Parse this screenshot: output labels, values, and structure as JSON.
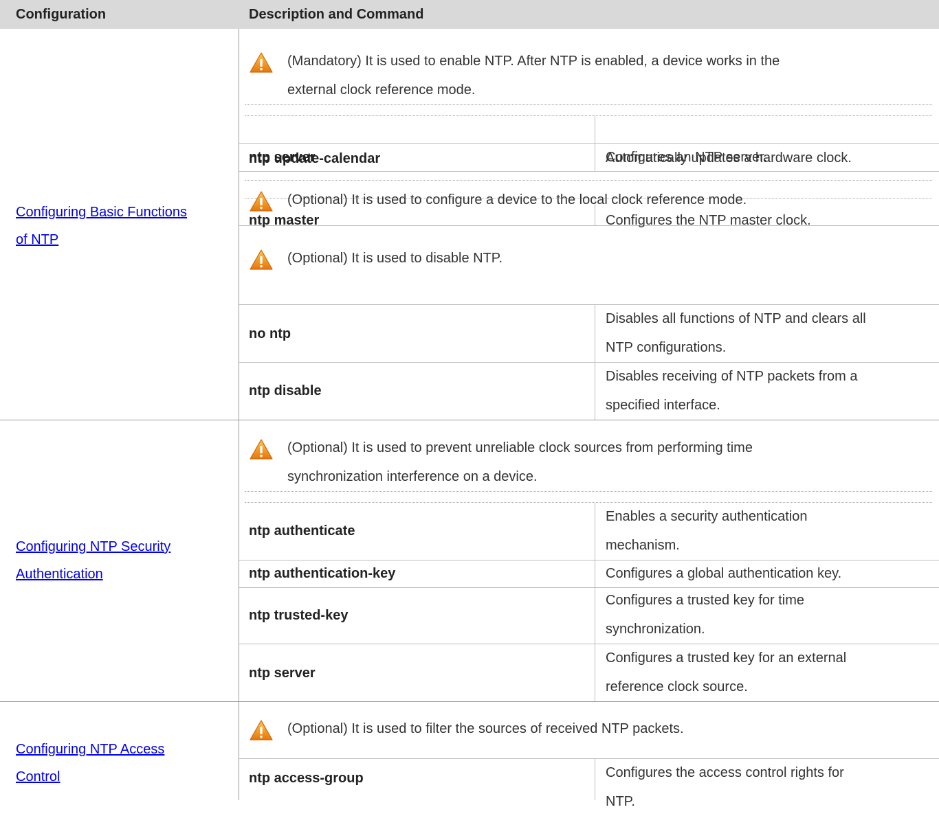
{
  "header": {
    "configuration": "Configuration",
    "description_and_command": "Description and Command"
  },
  "groups": [
    {
      "link": [
        "Configuring Basic Functions ",
        "of NTP"
      ],
      "notes": [
        [
          "(Mandatory) It is used to enable NTP. After NTP is enabled, a device works in the",
          "external clock reference mode."
        ],
        [
          "(Optional) It is used to configure a device to the local clock reference mode."
        ],
        [
          "(Optional) It is used to disable NTP."
        ]
      ],
      "commands": [
        {
          "command": "ntp server",
          "description": [
            "Configures an NTP server."
          ]
        },
        {
          "command": "ntp update-calendar",
          "description": [
            "Automatically updates a hardware clock."
          ]
        },
        {
          "command": "ntp master",
          "description": [
            "Configures the NTP master clock."
          ]
        },
        {
          "command": "no ntp",
          "description": [
            "Disables all functions of NTP and clears all",
            "NTP configurations."
          ]
        },
        {
          "command": "ntp disable",
          "description": [
            "Disables receiving of NTP packets from a",
            "specified interface."
          ]
        }
      ]
    },
    {
      "link": [
        "Configuring NTP Security ",
        "Authentication"
      ],
      "notes": [
        [
          "(Optional) It is used to prevent unreliable clock sources from performing time",
          "synchronization interference on a device."
        ]
      ],
      "commands": [
        {
          "command": "ntp authenticate",
          "description": [
            "Enables a security authentication",
            "mechanism."
          ]
        },
        {
          "command": "ntp authentication-key",
          "description": [
            "Configures a global authentication key."
          ]
        },
        {
          "command": "ntp trusted-key",
          "description": [
            "Configures a trusted key for time",
            "synchronization."
          ]
        },
        {
          "command": "ntp server",
          "description": [
            "Configures a trusted key for an external",
            "reference clock source."
          ]
        }
      ]
    },
    {
      "link": [
        "Configuring NTP Access ",
        "Control"
      ],
      "notes": [
        [
          "(Optional) It is used to filter the sources of received NTP packets."
        ]
      ],
      "commands": [
        {
          "command": "ntp access-group",
          "description": [
            "Configures the access control rights for",
            "NTP."
          ]
        }
      ]
    }
  ],
  "colors": {
    "header_bg": "#d9d9d9",
    "link": "#0000ee",
    "warning_icon": "#f39c12"
  }
}
